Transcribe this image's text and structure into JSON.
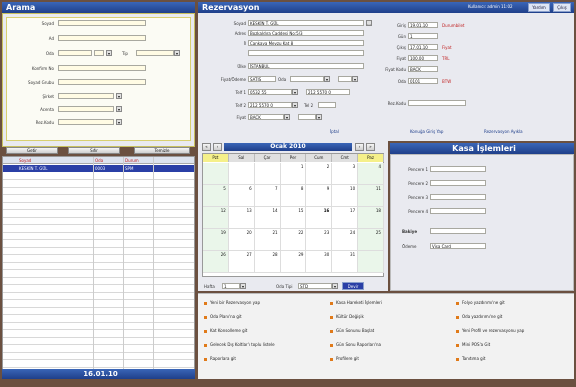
{
  "left": {
    "title": "Arama",
    "fields": [
      "Soyad",
      "Ad",
      "Oda",
      "Konfirm No",
      "Soyad Grubu",
      "Şirket",
      "Acenta",
      "Rez.Kodu"
    ],
    "tip_label": "Tip",
    "buttons": [
      "Getir",
      "Sıfır",
      "Temizle"
    ],
    "results_headers": [
      "Soyad",
      "Oda",
      "Durum"
    ],
    "results_row": [
      "KESKİN T. GÜL",
      "0003",
      "SPM"
    ],
    "footer_date": "16.01.10"
  },
  "header": {
    "title": "Rezervasyon",
    "user_text": "Kullanıcı: admin  11:02",
    "btn_yardim": "Yardım",
    "btn_cikis": "Çıkış"
  },
  "rez": {
    "labels": [
      "Soyad",
      "Adres",
      "İl",
      "Ülke",
      "Fiyat/Ödeme",
      "Telf 1",
      "Telf 2",
      "Fiyat"
    ],
    "values": [
      "KESKİN T. GÜL",
      "Bozkaldıra Caddesi No:5/3",
      "Çankaya Mevzu Kat 8",
      "İSTANBUL",
      "SATIS",
      "0532 55",
      "212 5570 0",
      "BACK"
    ],
    "oda_label": "Oda",
    "telf2_label": "Tel 2",
    "giris_label": "Giriş",
    "giris_value": "19.01.10",
    "giris_tag": "Durumbilet",
    "gun_label": "Gün",
    "gun_value": "1",
    "cikis_label": "Çıkış",
    "cikis_value": "17.01.10",
    "fiyat_label": "Fiyat",
    "fiyat_value": "100.00",
    "fiyat_red1": "Fiyat",
    "fiyat_red2": "TRL",
    "fiyatkodu_label": "Fiyat Kodu",
    "fiyatkodu_value": "BACK",
    "oda_value": "0101",
    "oda_tag": "BTW",
    "rezkodu_label": "Rez.Kodu",
    "links": [
      "İptal",
      "Konuğa Giriş Yap",
      "Rezervasyon Ayıkla"
    ]
  },
  "calendar": {
    "month": "Ocak 2010",
    "days": [
      "Pzt",
      "Sal",
      "Çar",
      "Per",
      "Cum",
      "Cmt",
      "Paz"
    ],
    "hafta_label": "Hafta",
    "hafta_value": "1",
    "odatipi_label": "Oda Tipi",
    "odatipi_value": "STD",
    "btn": "Devir"
  },
  "kasa": {
    "title": "Kasa İşlemleri",
    "rows": [
      "Pencere 1",
      "Pencere 2",
      "Pencere 3",
      "Pencere 4"
    ],
    "bakiye_label": "Bakiye",
    "odeme_label": "Ödeme",
    "odeme_value": "Visa Card"
  },
  "actions": {
    "col1": [
      "Yeni bir Rezervasyon yap",
      "Oda Planı'na git",
      "Kat Konsolleme git",
      "Gelecek Dış Koltlar'ı toplu listele",
      "Raporlara git"
    ],
    "col2": [
      "Kasa Hareketi İşlemleri",
      "Kültür Değişik",
      "Gün Sonunu Başlat",
      "Gün Sonu Raporları'na",
      "Profilere git"
    ],
    "col3": [
      "Folyo yazdırımı'ne git",
      "Oda yazdırımı'ne git",
      "Yeni Profil ve rezervasyonu yap",
      "Mini POS'a Git",
      "Tanıtıma git"
    ]
  }
}
